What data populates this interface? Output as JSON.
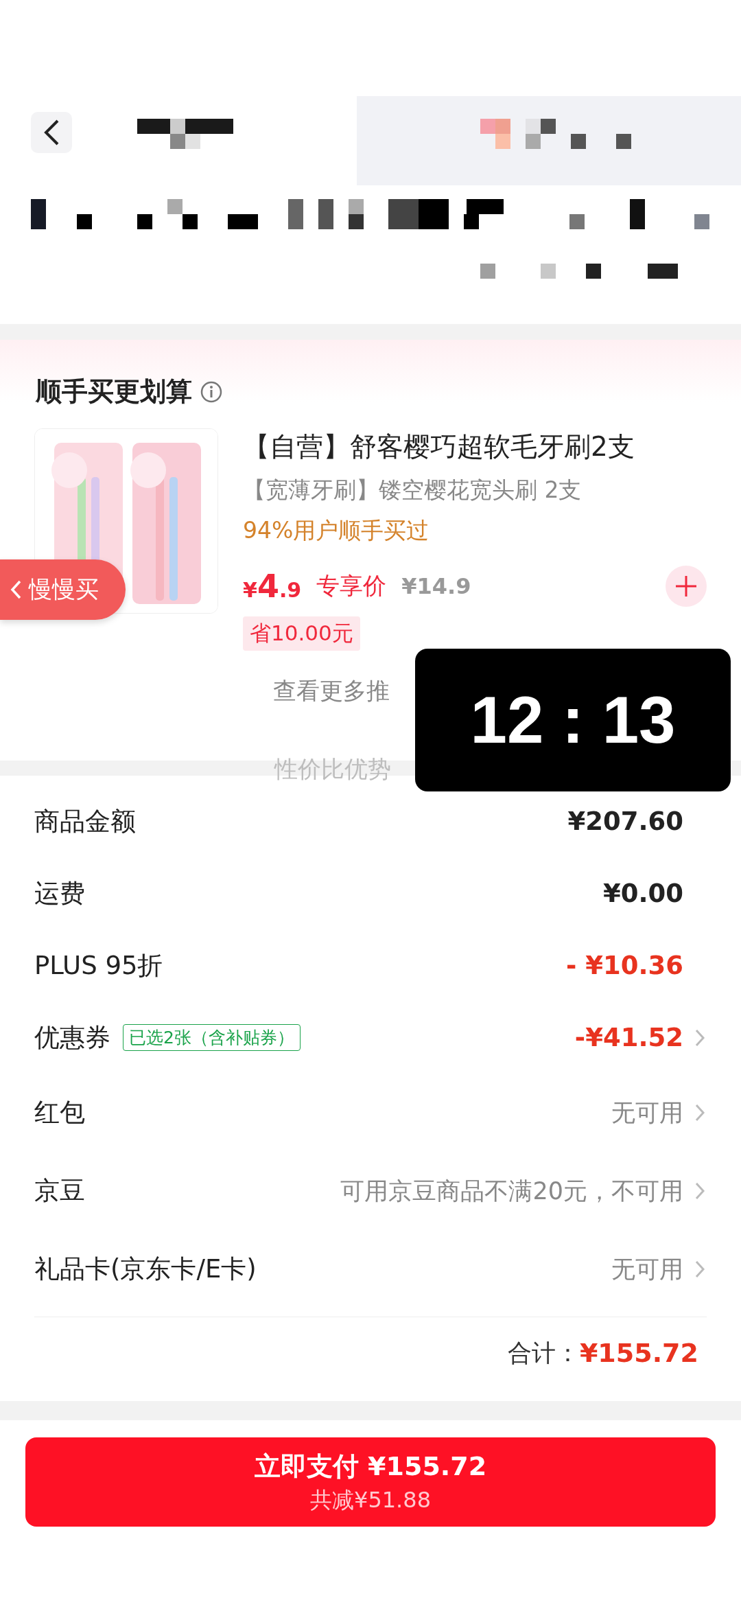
{
  "bundle": {
    "title": "顺手买更划算",
    "product": {
      "title": "【自营】舒客樱巧超软毛牙刷2支",
      "subtitle": "【宽薄牙刷】镂空樱花宽头刷 2支",
      "social_proof": "94%用户顺手买过",
      "price_symbol": "¥",
      "price_int": "4",
      "price_dec": ".9",
      "price_label": "专享价",
      "original_price": "¥14.9",
      "saving": "省10.00元"
    },
    "more": "查看更多推"
  },
  "float_tab": {
    "label": "慢慢买"
  },
  "summary": {
    "rows": [
      {
        "label": "商品金额",
        "value": "¥207.60",
        "kind": "amount",
        "chevron": false
      },
      {
        "label": "运费",
        "value": "¥0.00",
        "kind": "amount",
        "chevron": false
      },
      {
        "label": "PLUS 95折",
        "value": "- ¥10.36",
        "kind": "discount",
        "chevron": false
      },
      {
        "label": "优惠券",
        "tag": "已选2张（含补贴券）",
        "value": "-¥41.52",
        "kind": "discount",
        "chevron": true
      },
      {
        "label": "红包",
        "value": "无可用",
        "kind": "unavailable",
        "chevron": true
      },
      {
        "label": "京豆",
        "value": "可用京豆商品不满20元，不可用",
        "kind": "unavailable",
        "chevron": true
      },
      {
        "label": "礼品卡(京东卡/E卡)",
        "value": "无可用",
        "kind": "unavailable",
        "chevron": true
      }
    ],
    "total_label": "合计：",
    "total": "¥155.72"
  },
  "pay_button": {
    "label": "立即支付 ¥155.72",
    "savings": "共减¥51.88"
  },
  "clock_overlay": {
    "time": "12 : 13",
    "caption": "性价比优势"
  }
}
